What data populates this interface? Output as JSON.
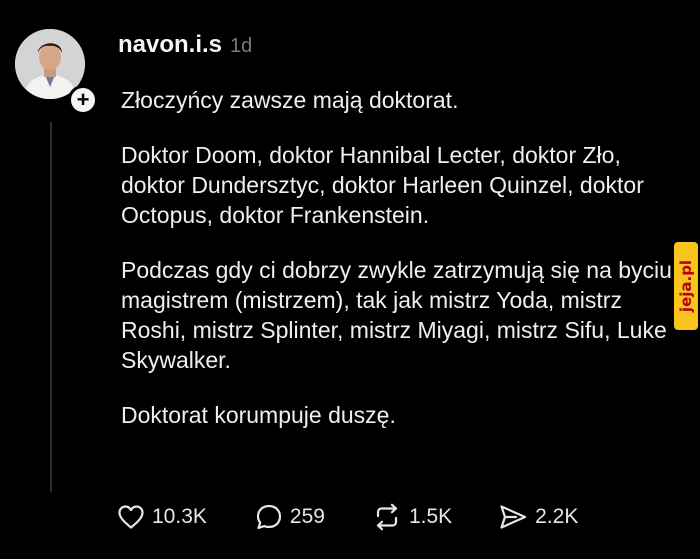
{
  "post": {
    "username": "navon.i.s",
    "time": "1d",
    "paragraphs": [
      "Złoczyńcy zawsze mają doktorat.",
      "Doktor Doom, doktor Hannibal Lecter, doktor Zło, doktor Dundersztyc, doktor Harleen Quinzel, doktor Octopus, doktor Frankenstein.",
      "Podczas gdy ci dobrzy zwykle zatrzymują się na byciu magistrem (mistrzem), tak jak mistrz Yoda, mistrz Roshi, mistrz Splinter, mistrz Miyagi, mistrz Sifu, Luke Skywalker.",
      "Doktorat korumpuje duszę."
    ]
  },
  "actions": {
    "likes": "10.3K",
    "comments": "259",
    "reposts": "1.5K",
    "shares": "2.2K"
  },
  "watermark": "jeja.pl",
  "icons": {
    "follow": "plus-icon",
    "like": "heart-icon",
    "comment": "speech-bubble-icon",
    "repost": "repost-icon",
    "share": "send-icon"
  },
  "colors": {
    "background": "#000000",
    "text": "#efefef",
    "muted": "#7a7a7a",
    "watermark_bg": "#f9c51c",
    "watermark_text": "#b3001b"
  }
}
